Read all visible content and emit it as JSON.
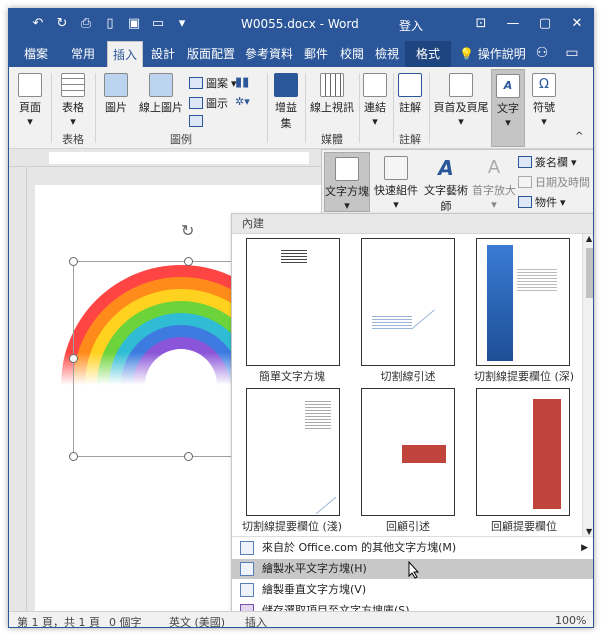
{
  "window": {
    "title": "W0055.docx - Word",
    "signin": "登入",
    "qat_icons": [
      "undo-icon",
      "redo-icon",
      "print-preview-icon",
      "new-document-icon",
      "save-icon",
      "open-icon",
      "customize-qat-icon"
    ]
  },
  "tabs": [
    {
      "label": "檔案"
    },
    {
      "label": "常用"
    },
    {
      "label": "插入"
    },
    {
      "label": "設計"
    },
    {
      "label": "版面配置"
    },
    {
      "label": "參考資料"
    },
    {
      "label": "郵件"
    },
    {
      "label": "校閱"
    },
    {
      "label": "檢視"
    },
    {
      "label": "格式"
    }
  ],
  "tell_me": "操作說明",
  "ribbon": {
    "page": "頁面",
    "table": "表格",
    "table_group": "表格",
    "picture": "圖片",
    "online_picture": "線上圖片",
    "shapes": "圖案",
    "smartart": "圖示",
    "illustrations_group": "圖例",
    "addins": "增益集",
    "online_video": "線上視訊",
    "media_group": "媒體",
    "link": "連結",
    "comment": "註解",
    "comments_group": "註解",
    "header_footer": "頁首及頁尾",
    "text": "文字",
    "symbols": "符號"
  },
  "text_group": {
    "textbox": "文字方塊",
    "quick_parts": "快速組件",
    "wordart": "文字藝術師",
    "dropcap": "首字放大",
    "signature_line": "簽名欄",
    "date_time": "日期及時間",
    "object": "物件"
  },
  "gallery": {
    "header": "內建",
    "items": [
      {
        "label": "簡單文字方塊"
      },
      {
        "label": "切割線引述"
      },
      {
        "label": "切割線提要欄位 (深)"
      },
      {
        "label": "切割線提要欄位 (淺)"
      },
      {
        "label": "回顧引述"
      },
      {
        "label": "回顧提要欄位"
      }
    ],
    "menu": [
      {
        "label": "來自於 Office.com 的其他文字方塊(M)"
      },
      {
        "label": "繪製水平文字方塊(H)"
      },
      {
        "label": "繪製垂直文字方塊(V)"
      },
      {
        "label": "儲存選取項目至文字方塊庫(S)"
      }
    ]
  },
  "status": {
    "page": "第 1 頁，共 1 頁",
    "words": "0 個字",
    "language": "英文 (美國)",
    "mode": "插入",
    "zoom": "100%"
  },
  "colors": {
    "word_blue": "#2b579a",
    "ribbon_bg": "#f1f1f1"
  }
}
